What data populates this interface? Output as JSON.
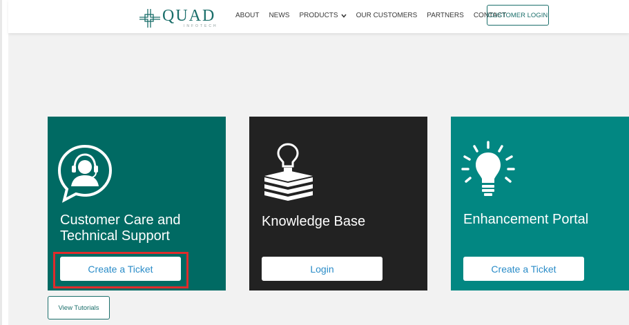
{
  "header": {
    "logo_text": "QUAD",
    "logo_subtext": "INFOTECH",
    "nav": [
      {
        "label": "ABOUT"
      },
      {
        "label": "NEWS"
      },
      {
        "label": "PRODUCTS"
      },
      {
        "label": "OUR CUSTOMERS"
      },
      {
        "label": "PARTNERS"
      },
      {
        "label": "CONTACT"
      }
    ],
    "login_label": "CUSTOMER LOGIN"
  },
  "cards": [
    {
      "title_line1": "Customer Care and",
      "title_line2": "Technical Support",
      "button_label": "Create a Ticket"
    },
    {
      "title_line1": "Knowledge Base",
      "button_label": "Login"
    },
    {
      "title_line1": "Enhancement Portal",
      "button_label": "Create a Ticket"
    }
  ],
  "tutorials_label": "View Tutorials",
  "colors": {
    "brand_teal": "#1a6e6a",
    "card_1": "#006a63",
    "card_2": "#222222",
    "card_3": "#028782",
    "button_text": "#2a8cc8",
    "highlight": "#e02b2b"
  },
  "icons": {
    "card_1": "headset-support-icon",
    "card_2": "books-lightbulb-icon",
    "card_3": "lightbulb-idea-icon",
    "products_dropdown": "chevron-down-icon"
  }
}
